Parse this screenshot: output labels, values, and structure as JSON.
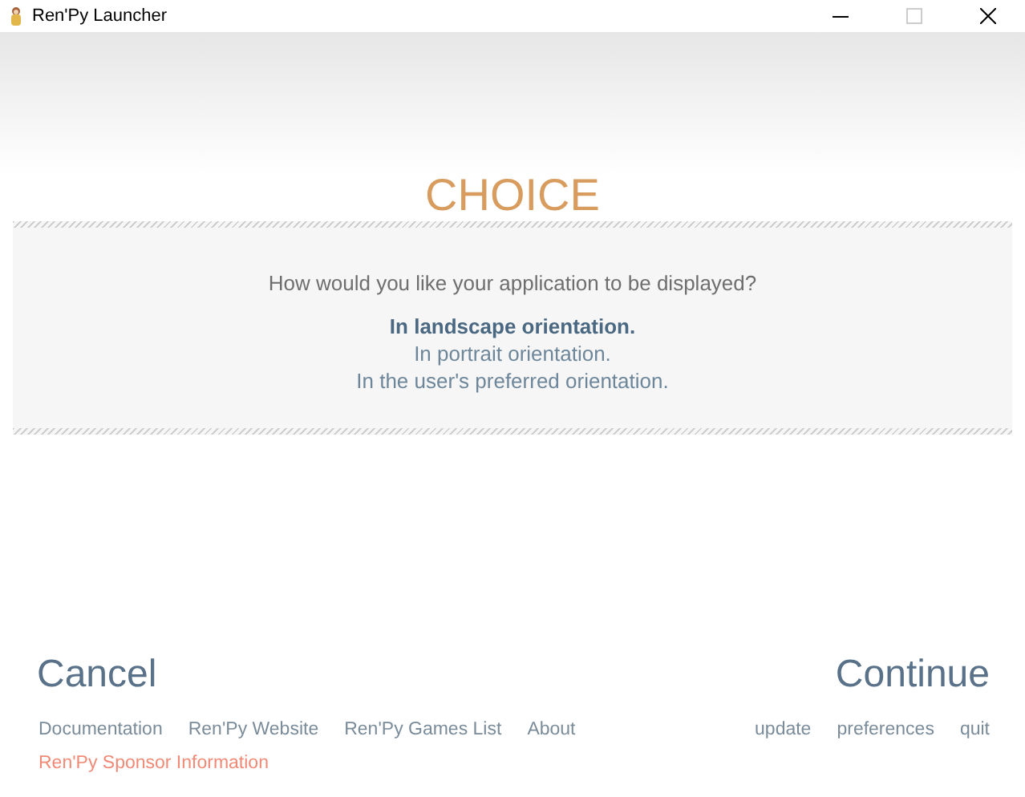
{
  "window": {
    "title": "Ren'Py Launcher"
  },
  "heading": "CHOICE",
  "question": "How would you like your application to be displayed?",
  "options": [
    {
      "label": "In landscape orientation.",
      "selected": true
    },
    {
      "label": "In portrait orientation.",
      "selected": false
    },
    {
      "label": "In the user's preferred orientation.",
      "selected": false
    }
  ],
  "cancel": "Cancel",
  "continue": "Continue",
  "links": [
    {
      "label": "Documentation",
      "kind": "normal"
    },
    {
      "label": "Ren'Py Website",
      "kind": "normal"
    },
    {
      "label": "Ren'Py Games List",
      "kind": "normal"
    },
    {
      "label": "About",
      "kind": "normal"
    },
    {
      "label": "Ren'Py Sponsor Information",
      "kind": "sponsor"
    }
  ],
  "right_links": [
    "update",
    "preferences",
    "quit"
  ]
}
